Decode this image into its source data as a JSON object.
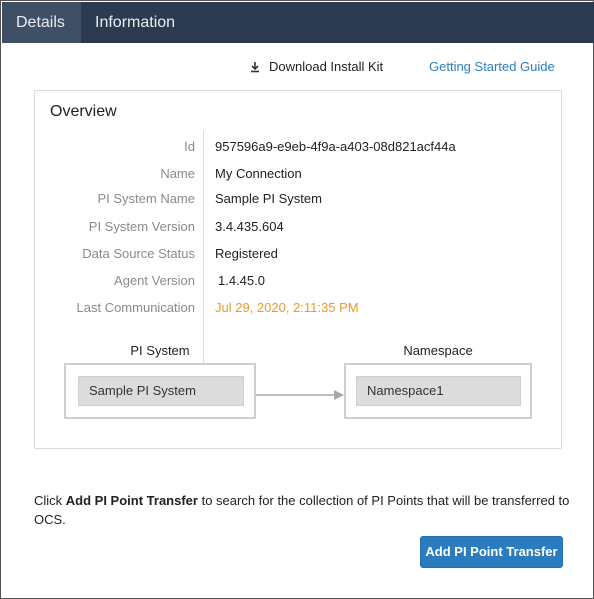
{
  "tabs": [
    {
      "label": "Details",
      "active": true
    },
    {
      "label": "Information",
      "active": false
    }
  ],
  "toolbar": {
    "download_label": "Download Install Kit",
    "download_icon": "download-icon",
    "guide_label": "Getting Started Guide"
  },
  "overview": {
    "title": "Overview",
    "rows": [
      {
        "label": "Id",
        "value": "957596a9-e9eb-4f9a-a403-08d821acf44a"
      },
      {
        "label": "Name",
        "value": "My Connection"
      },
      {
        "label": "PI System Name",
        "value": "Sample PI System"
      },
      {
        "label": "PI System Version",
        "value": "3.4.435.604"
      },
      {
        "label": "Data Source Status",
        "value": "Registered"
      },
      {
        "label": "Agent Version",
        "value": "1.4.45.0"
      },
      {
        "label": "Last Communication",
        "value": "Jul 29, 2020, 2:11:35 PM"
      }
    ],
    "diagram": {
      "source_title": "PI System",
      "source_value": "Sample PI System",
      "target_title": "Namespace",
      "target_value": "Namespace1"
    }
  },
  "footer": {
    "text_prefix": "Click ",
    "text_bold": "Add PI Point Transfer",
    "text_suffix": " to search for the collection of PI Points that will be transferred to OCS.",
    "button_label": "Add PI Point Transfer"
  },
  "colors": {
    "tabbar": "#2b3a4e",
    "tab_active": "#3e4f66",
    "link": "#2d7fc2",
    "warning": "#e89a2e",
    "primary": "#2b7bbf"
  }
}
